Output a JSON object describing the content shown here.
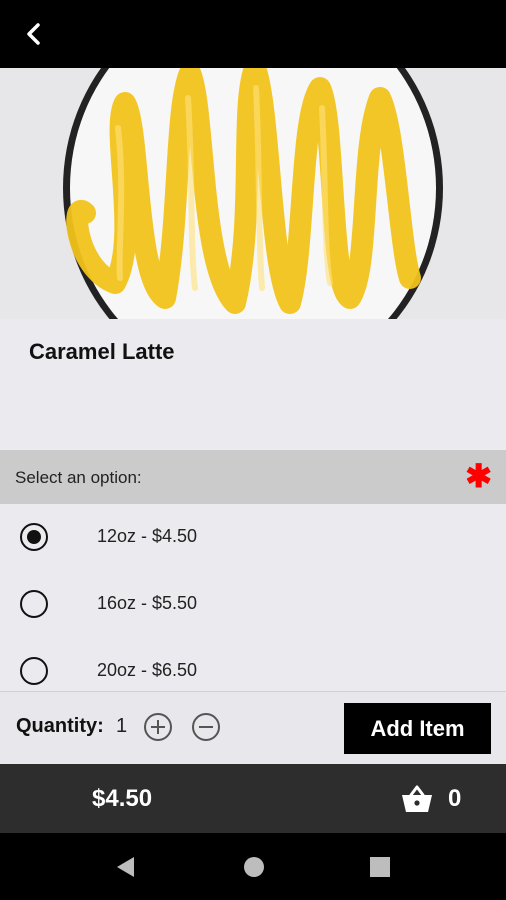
{
  "header": {
    "back_icon": "chevron-left-icon"
  },
  "product": {
    "title": "Caramel Latte",
    "image": "caramel-latte-photo"
  },
  "options": {
    "header_label": "Select an option:",
    "required_mark": "✱",
    "items": [
      {
        "label": "12oz - $4.50",
        "selected": true
      },
      {
        "label": "16oz - $5.50",
        "selected": false
      },
      {
        "label": "20oz - $6.50",
        "selected": false
      }
    ]
  },
  "quantity": {
    "label": "Quantity:",
    "value": "1",
    "increment_icon": "plus-circle-icon",
    "decrement_icon": "minus-circle-icon"
  },
  "actions": {
    "add_item_label": "Add Item"
  },
  "footer": {
    "total_price": "$4.50",
    "cart_icon": "basket-icon",
    "cart_count": "0"
  },
  "system_nav": {
    "back": "nav-back-icon",
    "home": "nav-home-icon",
    "recents": "nav-recents-icon"
  },
  "colors": {
    "accent_required": "#ff0000",
    "primary_button": "#000000",
    "footer_bg": "#2d2d2d"
  }
}
